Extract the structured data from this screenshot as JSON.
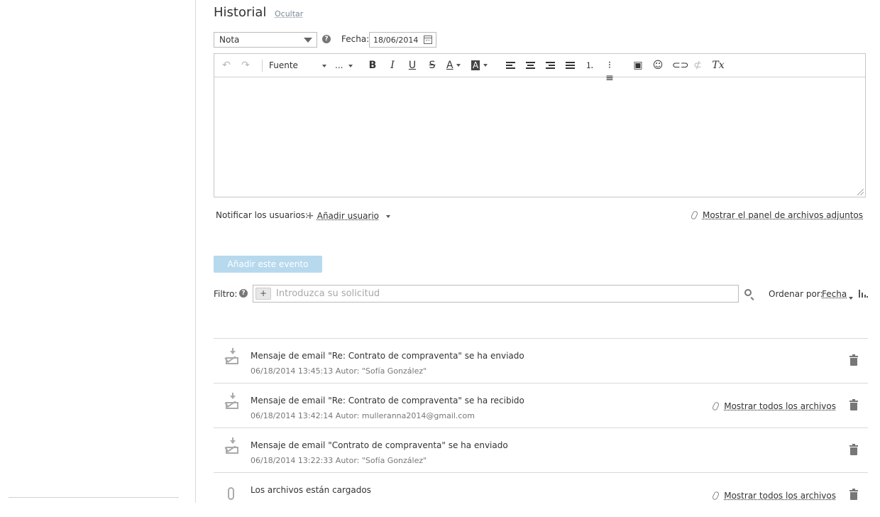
{
  "history": {
    "title": "Historial",
    "hide_label": "Ocultar"
  },
  "form": {
    "type_value": "Nota",
    "date_label": "Fecha:",
    "date_value": "18/06/2014"
  },
  "toolbar": {
    "font_label": "Fuente",
    "size_label": "...",
    "bold": "B",
    "italic": "I",
    "underline": "U",
    "strike": "S",
    "text_color": "A",
    "bg_color": "A",
    "clear_format": "Tx"
  },
  "notify": {
    "label": "Notificar los usuarios:",
    "add_user": "Añadir usuario",
    "attachments_panel": "Mostrar el panel de archivos adjuntos"
  },
  "add_event_button": "Añadir este evento",
  "filter": {
    "label": "Filtro:",
    "placeholder": "Introduzca su solicitud",
    "sort_label": "Ordenar por:",
    "sort_value": "Fecha"
  },
  "events": [
    {
      "icon": "envelope-icon",
      "title": "Mensaje de email \"Re: Contrato de compraventa\" se ha enviado",
      "meta": "06/18/2014 13:45:13 Autor: \"Sofía González\"",
      "files_link": ""
    },
    {
      "icon": "envelope-icon",
      "title": "Mensaje de email \"Re: Contrato de compraventa\" se ha recibido",
      "meta": "06/18/2014 13:42:14 Autor: mulleranna2014@gmail.com",
      "files_link": "Mostrar todos los archivos"
    },
    {
      "icon": "envelope-icon",
      "title": "Mensaje de email \"Contrato de compraventa\" se ha enviado",
      "meta": "06/18/2014 13:22:33 Autor: \"Sofía González\"",
      "files_link": ""
    },
    {
      "icon": "paperclip-icon",
      "title": "Los archivos están cargados",
      "meta": "",
      "files_link": "Mostrar todos los archivos"
    }
  ]
}
